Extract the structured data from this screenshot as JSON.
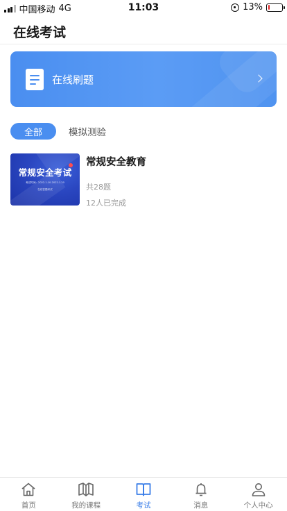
{
  "status_bar": {
    "carrier": "中国移动",
    "network": "4G",
    "time": "11:03",
    "battery_percent": "13%",
    "battery_level": 0.13
  },
  "header": {
    "title": "在线考试"
  },
  "banner": {
    "label": "在线刷题",
    "icon": "document-icon"
  },
  "filters": [
    {
      "label": "全部",
      "active": true
    },
    {
      "label": "模拟测验",
      "active": false
    }
  ],
  "exams": [
    {
      "title": "常规安全教育",
      "cover_title": "常规安全考试",
      "cover_line1": "考试时间：2022.1.10-2022.1.20",
      "cover_line2": "在线答题考试",
      "question_count": "共28题",
      "completed": "12人已完成"
    }
  ],
  "nav": [
    {
      "label": "首页",
      "icon": "home-icon",
      "active": false
    },
    {
      "label": "我的课程",
      "icon": "book-icon",
      "active": false
    },
    {
      "label": "考试",
      "icon": "exam-icon",
      "active": true
    },
    {
      "label": "消息",
      "icon": "bell-icon",
      "active": false
    },
    {
      "label": "个人中心",
      "icon": "user-icon",
      "active": false
    }
  ],
  "colors": {
    "accent": "#4a8ef0",
    "nav_active": "#3a7ee8",
    "battery_low": "#e02020"
  }
}
